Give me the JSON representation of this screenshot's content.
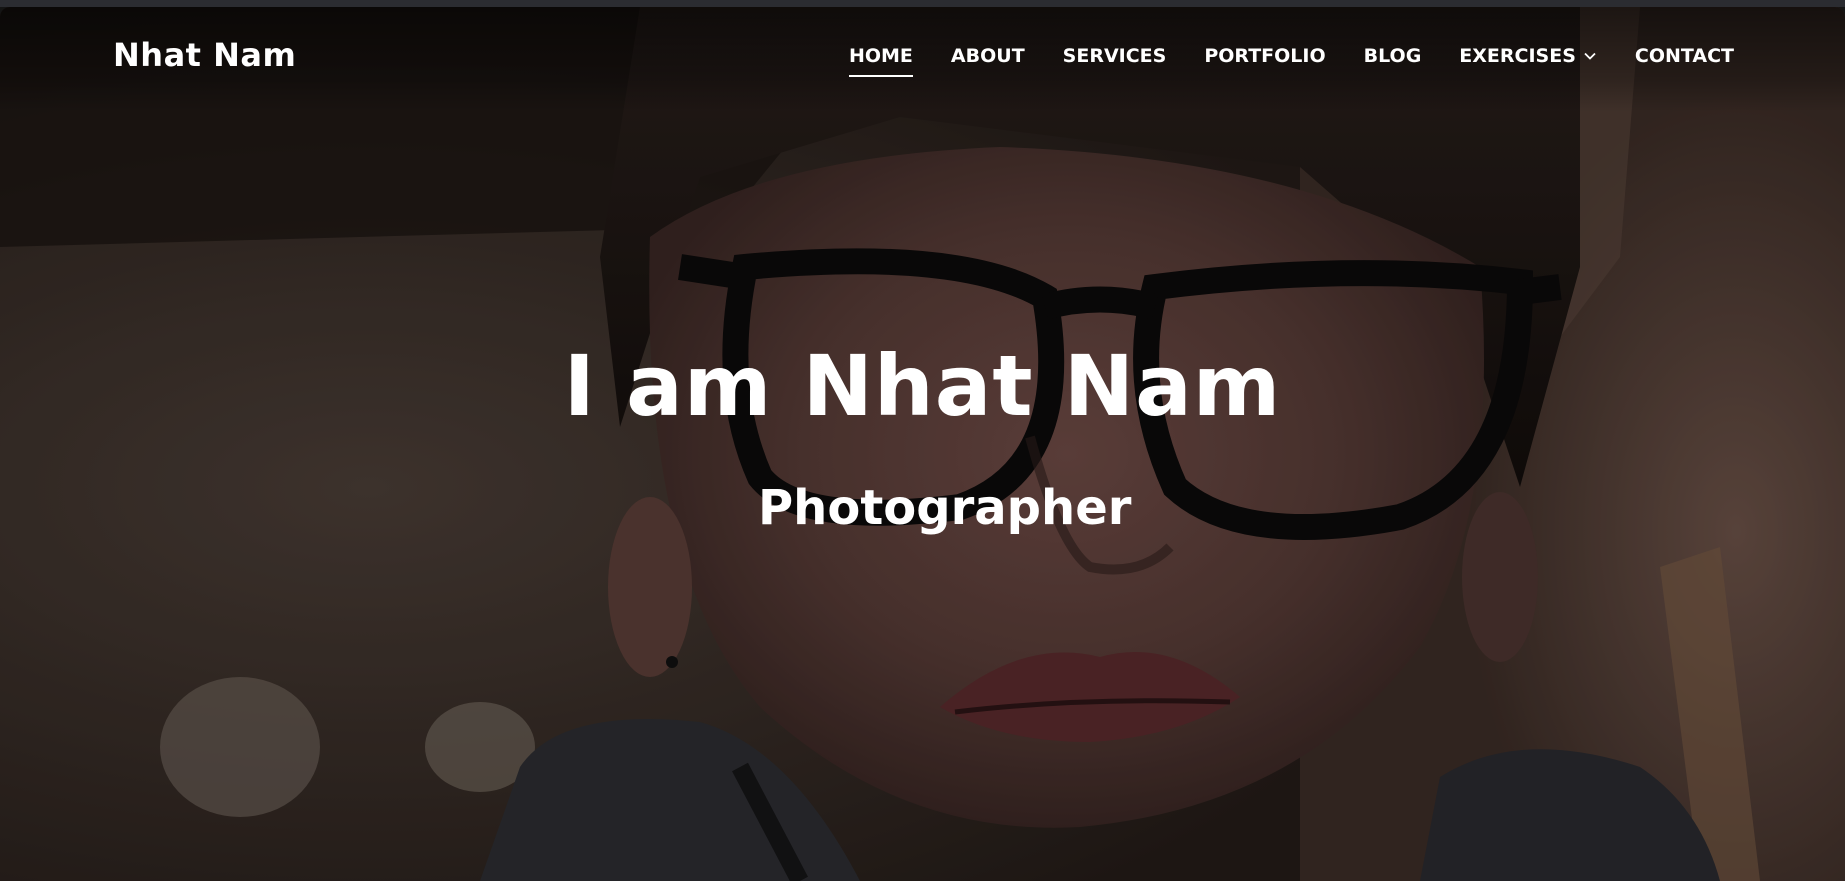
{
  "site": {
    "logo": "Nhat Nam"
  },
  "nav": {
    "items": [
      {
        "label": "HOME",
        "active": true
      },
      {
        "label": "ABOUT"
      },
      {
        "label": "SERVICES"
      },
      {
        "label": "PORTFOLIO"
      },
      {
        "label": "BLOG"
      },
      {
        "label": "EXERCISES",
        "dropdown_icon": "chevron-down-icon"
      },
      {
        "label": "CONTACT"
      }
    ]
  },
  "hero": {
    "title": "I am Nhat Nam",
    "subtitle": "Photographer",
    "background": "portrait-photo"
  },
  "colors": {
    "text": "#ffffff",
    "window_strip": "#2b2c31"
  }
}
